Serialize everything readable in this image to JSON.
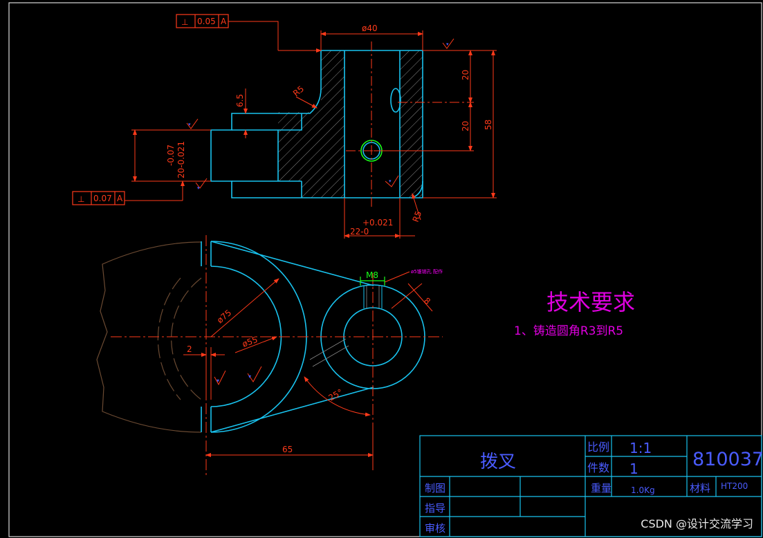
{
  "tech_requirements": {
    "title": "技术要求",
    "item_1": "1、铸造圆角R3到R5"
  },
  "dimensions": {
    "dia_40": "ø40",
    "v_20_upper": "20",
    "v_20_lower": "20",
    "v_58": "58",
    "v_6_5": "6.5",
    "r5_upper": "R5",
    "r5_lower": "R5",
    "tol_minus": "-0.07",
    "tol_base": "20-0.021",
    "bore_tol_plus": "+0.021",
    "bore_base": "22-0",
    "dia_75": "ø75",
    "dia_55": "ø55",
    "dim_2": "2",
    "thread_m8": "M8",
    "dim_8": "8",
    "angle_25": "25°",
    "dim_65": "65",
    "hole_note": "ø5锥销孔 配作"
  },
  "gdt": {
    "upper": {
      "symbol": "⊥",
      "value": "0.05",
      "datum": "A"
    },
    "lower": {
      "symbol": "⊥",
      "value": "0.07",
      "datum": "A"
    }
  },
  "title_block": {
    "part_name": "拨叉",
    "scale_label": "比例",
    "scale_value": "1:1",
    "qty_label": "件数",
    "qty_value": "1",
    "drawing_no": "810037",
    "drawn_label": "制图",
    "guide_label": "指导",
    "review_label": "审核",
    "weight_label": "重量",
    "weight_value": "1.0Kg",
    "material_label": "材料",
    "material_value": "HT200"
  },
  "watermark": "CSDN @设计交流学习",
  "colors": {
    "outline": "#19c4f0",
    "dimension": "#ff3a1a",
    "centerline": "#ff3a1a",
    "hatch": "#8a8a8a",
    "phantom": "#6b4a32",
    "title_text": "#4a5cff",
    "requirements": "#e000e0",
    "thread": "#1aff1a"
  }
}
